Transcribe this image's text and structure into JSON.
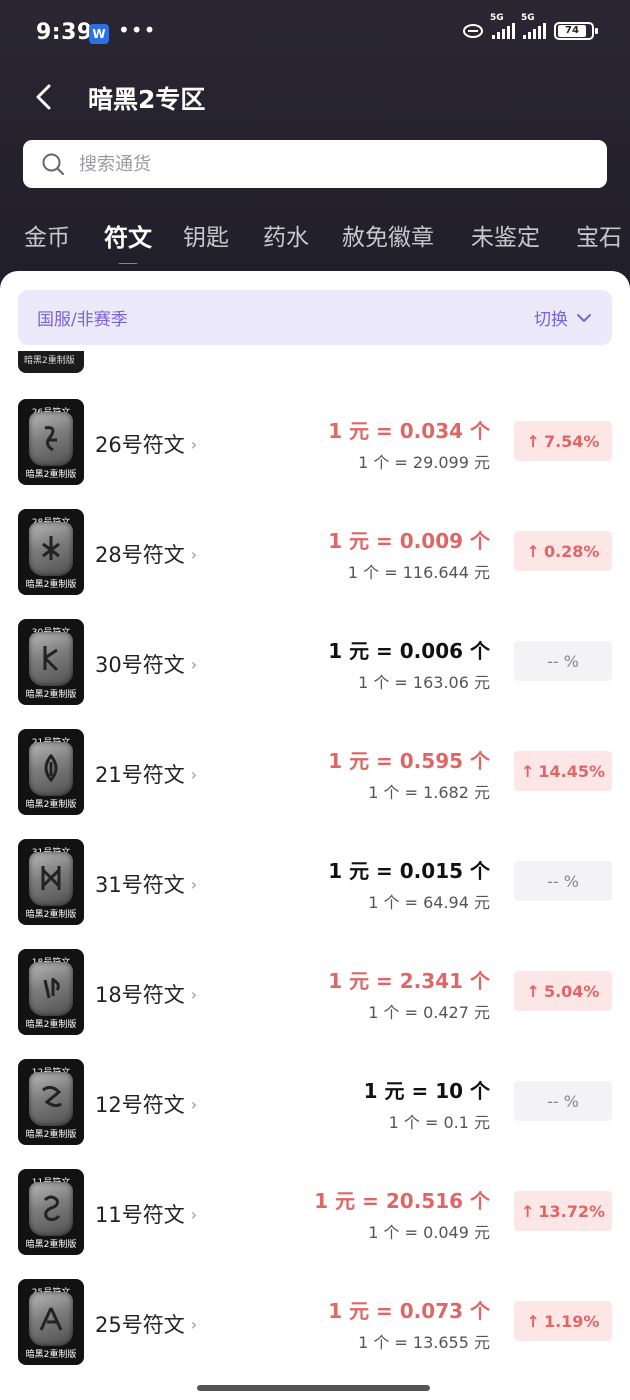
{
  "status_bar": {
    "time": "9:39",
    "app_badge": "W",
    "dots": "•••",
    "net1": "5G",
    "net2": "5G",
    "battery": "74"
  },
  "header": {
    "title": "暗黑2专区"
  },
  "search": {
    "placeholder": "搜索通货"
  },
  "tabs": [
    {
      "label": "金币",
      "active": false
    },
    {
      "label": "符文",
      "active": true
    },
    {
      "label": "钥匙",
      "active": false
    },
    {
      "label": "药水",
      "active": false
    },
    {
      "label": "赦免徽章",
      "active": false
    },
    {
      "label": "未鉴定",
      "active": false
    },
    {
      "label": "宝石",
      "active": false
    }
  ],
  "region": {
    "label": "国服/非赛季",
    "switch_label": "切换"
  },
  "partial_row": {
    "label": "暗黑2重制版"
  },
  "items": [
    {
      "badge_top": "26号符文",
      "badge_bottom": "暗黑2重制版",
      "name": "26号符文",
      "rate1": "1 元 = 0.034 个",
      "rate2": "1 个 = 29.099 元",
      "change": "7.54%",
      "trend": "up"
    },
    {
      "badge_top": "28号符文",
      "badge_bottom": "暗黑2重制版",
      "name": "28号符文",
      "rate1": "1 元 = 0.009 个",
      "rate2": "1 个 = 116.644 元",
      "change": "0.28%",
      "trend": "up"
    },
    {
      "badge_top": "30号符文",
      "badge_bottom": "暗黑2重制版",
      "name": "30号符文",
      "rate1": "1 元 = 0.006 个",
      "rate2": "1 个 = 163.06 元",
      "change": "-- %",
      "trend": "flat"
    },
    {
      "badge_top": "21号符文",
      "badge_bottom": "暗黑2重制版",
      "name": "21号符文",
      "rate1": "1 元 = 0.595 个",
      "rate2": "1 个 = 1.682 元",
      "change": "14.45%",
      "trend": "up"
    },
    {
      "badge_top": "31号符文",
      "badge_bottom": "暗黑2重制版",
      "name": "31号符文",
      "rate1": "1 元 = 0.015 个",
      "rate2": "1 个 = 64.94 元",
      "change": "-- %",
      "trend": "flat"
    },
    {
      "badge_top": "18号符文",
      "badge_bottom": "暗黑2重制版",
      "name": "18号符文",
      "rate1": "1 元 = 2.341 个",
      "rate2": "1 个 = 0.427 元",
      "change": "5.04%",
      "trend": "up"
    },
    {
      "badge_top": "12号符文",
      "badge_bottom": "暗黑2重制版",
      "name": "12号符文",
      "rate1": "1 元 = 10 个",
      "rate2": "1 个 = 0.1 元",
      "change": "-- %",
      "trend": "flat"
    },
    {
      "badge_top": "11号符文",
      "badge_bottom": "暗黑2重制版",
      "name": "11号符文",
      "rate1": "1 元 = 20.516 个",
      "rate2": "1 个 = 0.049 元",
      "change": "13.72%",
      "trend": "up"
    },
    {
      "badge_top": "25号符文",
      "badge_bottom": "暗黑2重制版",
      "name": "25号符文",
      "rate1": "1 元 = 0.073 个",
      "rate2": "1 个 = 13.655 元",
      "change": "1.19%",
      "trend": "up"
    }
  ],
  "colors": {
    "accent": "#8f6cf0",
    "up": "#e06666",
    "up_bg": "#fde6e6",
    "header_bg": "#24222c"
  }
}
